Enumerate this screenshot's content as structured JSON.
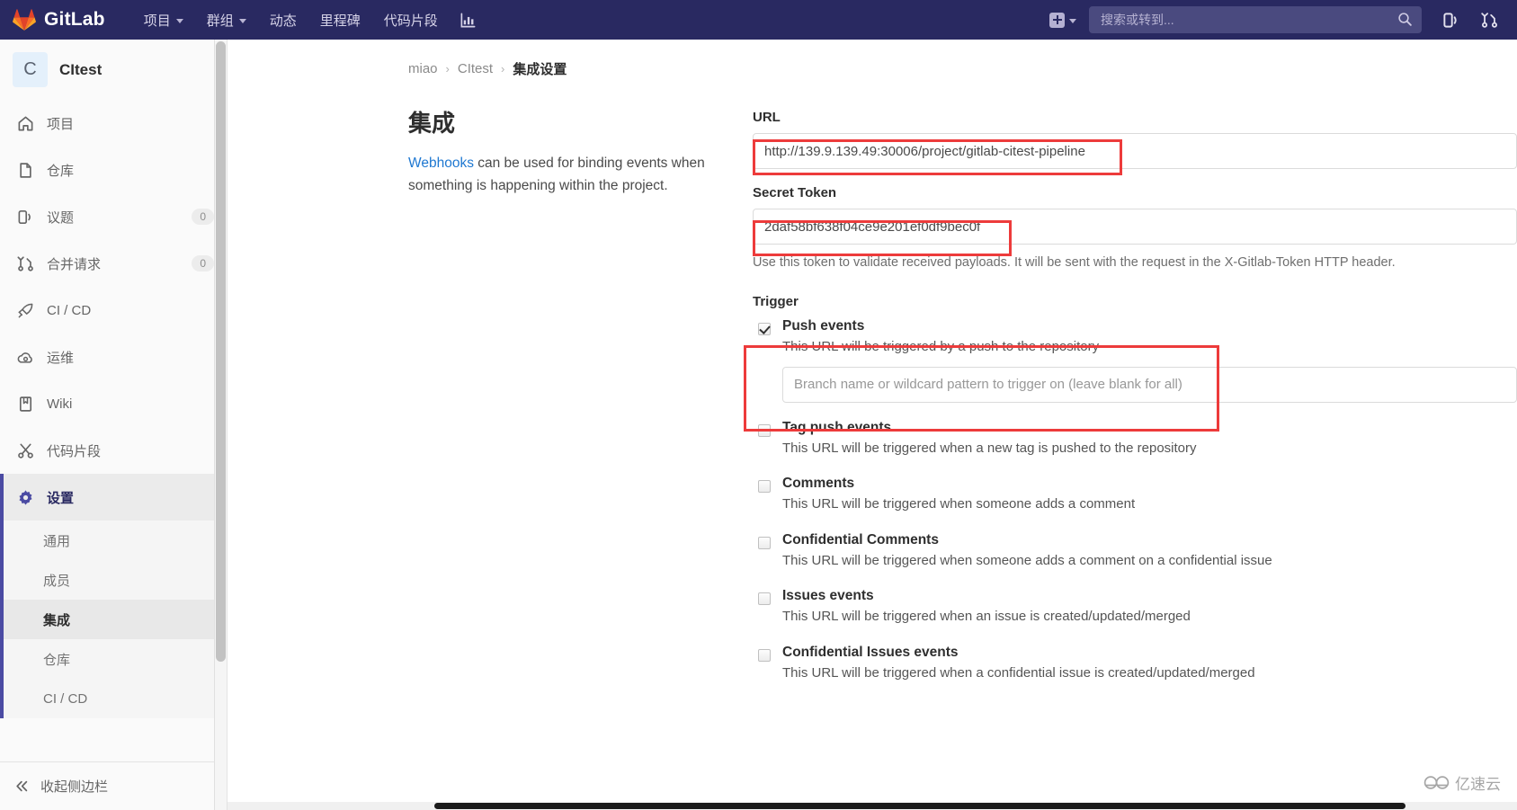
{
  "navbar": {
    "brand": "GitLab",
    "logo_icon": "gitlab-fox-logo-icon",
    "links": [
      {
        "label": "项目",
        "has_caret": true
      },
      {
        "label": "群组",
        "has_caret": true
      },
      {
        "label": "动态",
        "has_caret": false
      },
      {
        "label": "里程碑",
        "has_caret": false
      },
      {
        "label": "代码片段",
        "has_caret": false
      }
    ],
    "analytics_icon": "bar-chart-icon",
    "new_icon": "plus-square-icon",
    "new_caret_icon": "chevron-down-icon",
    "search": {
      "placeholder": "搜索或转到...",
      "value": "",
      "icon": "search-icon"
    },
    "issues_icon": "issues-icon",
    "merge_requests_icon": "merge-request-icon"
  },
  "sidebar": {
    "project": {
      "avatar_initial": "C",
      "name": "CItest"
    },
    "items": [
      {
        "label": "项目",
        "icon": "home-icon",
        "badge": "",
        "active": false
      },
      {
        "label": "仓库",
        "icon": "file-document-icon",
        "badge": "",
        "active": false
      },
      {
        "label": "议题",
        "icon": "issues-icon",
        "badge": "0",
        "active": false
      },
      {
        "label": "合并请求",
        "icon": "merge-request-icon",
        "badge": "0",
        "active": false
      },
      {
        "label": "CI / CD",
        "icon": "rocket-icon",
        "badge": "",
        "active": false
      },
      {
        "label": "运维",
        "icon": "cloud-gear-icon",
        "badge": "",
        "active": false
      },
      {
        "label": "Wiki",
        "icon": "book-icon",
        "badge": "",
        "active": false
      },
      {
        "label": "代码片段",
        "icon": "scissors-icon",
        "badge": "",
        "active": false
      }
    ],
    "settings": {
      "label": "设置",
      "icon": "gear-icon",
      "active": true
    },
    "sub_items": [
      {
        "label": "通用",
        "active": false
      },
      {
        "label": "成员",
        "active": false
      },
      {
        "label": "集成",
        "active": true
      },
      {
        "label": "仓库",
        "active": false
      },
      {
        "label": "CI / CD",
        "active": false
      }
    ],
    "collapse": {
      "label": "收起侧边栏",
      "icon": "chevron-double-left-icon"
    }
  },
  "breadcrumb": {
    "items": [
      "miao",
      "CItest"
    ],
    "separator": "›",
    "current": "集成设置"
  },
  "panel": {
    "title": "集成",
    "desc_link": "Webhooks",
    "desc_rest": " can be used for binding events when something is happening within the project."
  },
  "form": {
    "url": {
      "label": "URL",
      "value": "http://139.9.139.49:30006/project/gitlab-citest-pipeline",
      "placeholder": ""
    },
    "secret_token": {
      "label": "Secret Token",
      "value": "2daf58bf638f04ce9e201ef0df9bec0f",
      "placeholder": "",
      "help": "Use this token to validate received payloads. It will be sent with the request in the X-Gitlab-Token HTTP header."
    },
    "trigger_label": "Trigger",
    "branch_filter": {
      "placeholder": "Branch name or wildcard pattern to trigger on (leave blank for all)",
      "value": ""
    },
    "events": [
      {
        "title": "Push events",
        "desc": "This URL will be triggered by a push to the repository",
        "checked": true,
        "has_branch_input": true
      },
      {
        "title": "Tag push events",
        "desc": "This URL will be triggered when a new tag is pushed to the repository",
        "checked": false,
        "has_branch_input": false
      },
      {
        "title": "Comments",
        "desc": "This URL will be triggered when someone adds a comment",
        "checked": false,
        "has_branch_input": false
      },
      {
        "title": "Confidential Comments",
        "desc": "This URL will be triggered when someone adds a comment on a confidential issue",
        "checked": false,
        "has_branch_input": false
      },
      {
        "title": "Issues events",
        "desc": "This URL will be triggered when an issue is created/updated/merged",
        "checked": false,
        "has_branch_input": false
      },
      {
        "title": "Confidential Issues events",
        "desc": "This URL will be triggered when a confidential issue is created/updated/merged",
        "checked": false,
        "has_branch_input": false
      }
    ]
  },
  "watermark": {
    "text": "亿速云"
  },
  "colors": {
    "navbar_bg": "#292961",
    "accent": "#4b4ba3",
    "link": "#1f78d1",
    "annotation": "#ed3b3b",
    "sidebar_bg": "#fafafa"
  }
}
